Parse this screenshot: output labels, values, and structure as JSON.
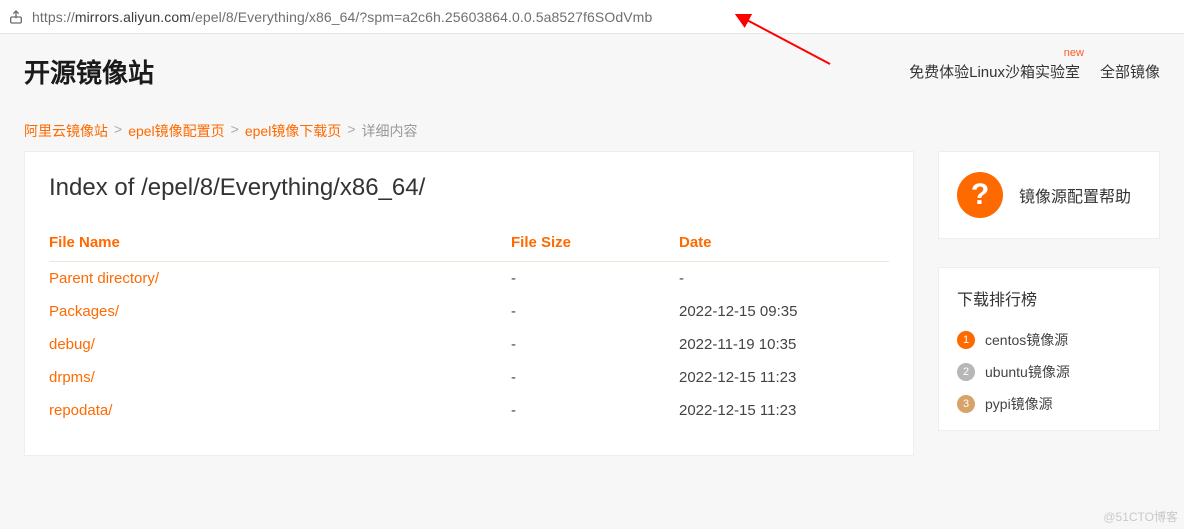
{
  "url": {
    "prefix": "https://",
    "host": "mirrors.aliyun.com",
    "path": "/epel/8/Everything/x86_64/?spm=a2c6h.25603864.0.0.5a8527f6SOdVmb"
  },
  "header": {
    "site_title": "开源镜像站",
    "link_sandbox": "免费体验Linux沙箱实验室",
    "link_all": "全部镜像",
    "badge_new": "new"
  },
  "breadcrumb": {
    "items": [
      "阿里云镜像站",
      "epel镜像配置页",
      "epel镜像下载页"
    ],
    "current": "详细内容"
  },
  "main": {
    "index_title": "Index of /epel/8/Everything/x86_64/",
    "cols": {
      "name": "File Name",
      "size": "File Size",
      "date": "Date"
    },
    "rows": [
      {
        "name": "Parent directory/",
        "size": "-",
        "date": "-"
      },
      {
        "name": "Packages/",
        "size": "-",
        "date": "2022-12-15 09:35"
      },
      {
        "name": "debug/",
        "size": "-",
        "date": "2022-11-19 10:35"
      },
      {
        "name": "drpms/",
        "size": "-",
        "date": "2022-12-15 11:23"
      },
      {
        "name": "repodata/",
        "size": "-",
        "date": "2022-12-15 11:23"
      }
    ]
  },
  "side": {
    "help_text": "镜像源配置帮助",
    "rank_title": "下载排行榜",
    "rank": [
      "centos镜像源",
      "ubuntu镜像源",
      "pypi镜像源"
    ]
  },
  "watermark": "@51CTO博客"
}
